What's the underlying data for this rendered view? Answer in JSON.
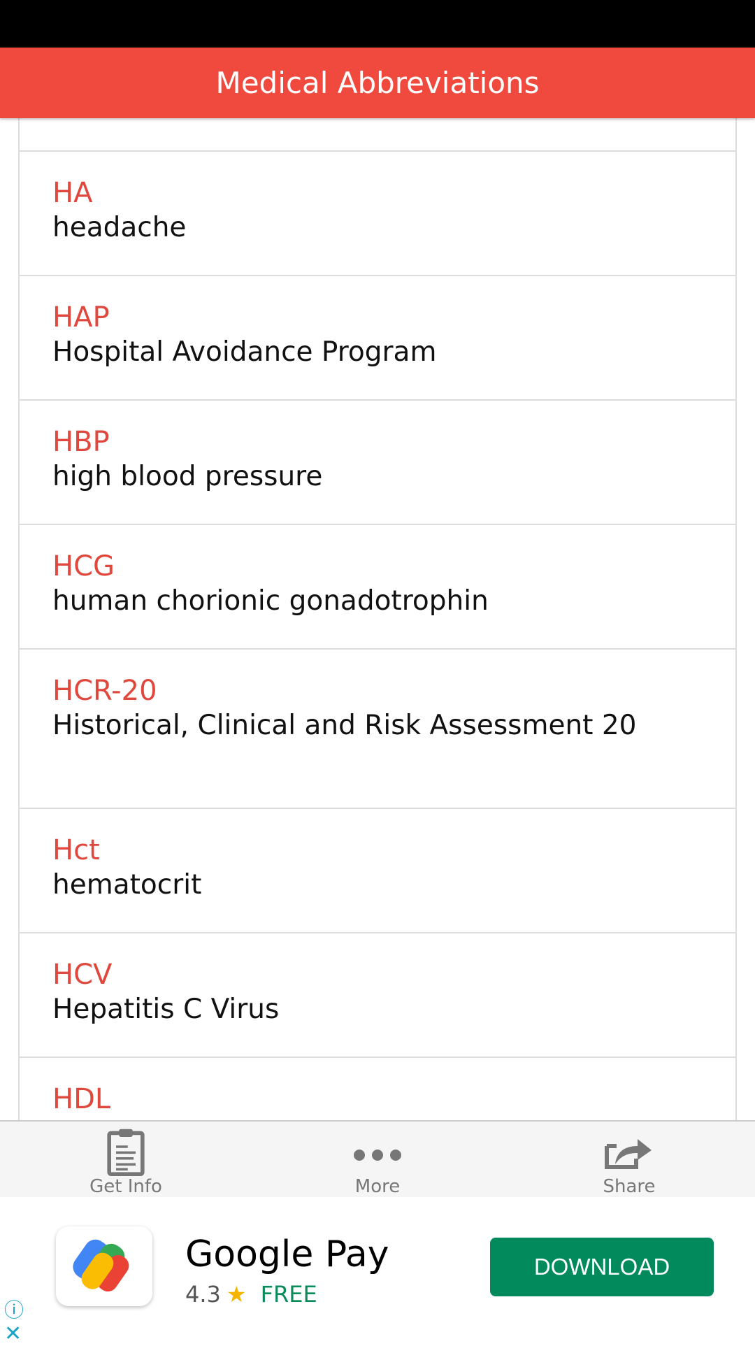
{
  "header": {
    "title": "Medical Abbreviations"
  },
  "items": [
    {
      "abbr": "HA",
      "def": "headache"
    },
    {
      "abbr": "HAP",
      "def": "Hospital Avoidance Program"
    },
    {
      "abbr": "HBP",
      "def": "high blood pressure"
    },
    {
      "abbr": "HCG",
      "def": "human chorionic gonadotrophin"
    },
    {
      "abbr": "HCR-20",
      "def": "Historical, Clinical and Risk Assessment 20"
    },
    {
      "abbr": "Hct",
      "def": "hematocrit"
    },
    {
      "abbr": "HCV",
      "def": "Hepatitis C Virus"
    },
    {
      "abbr": "HDL",
      "def": ""
    }
  ],
  "bottom_bar": [
    {
      "label": "Get Info",
      "icon": "clipboard-icon"
    },
    {
      "label": "More",
      "icon": "more-dots-icon"
    },
    {
      "label": "Share",
      "icon": "share-icon"
    }
  ],
  "ad": {
    "app_name": "Google Pay",
    "rating": "4.3",
    "price": "FREE",
    "button": "DOWNLOAD",
    "info": "ⓘ",
    "close": "✕"
  },
  "colors": {
    "header": "#f04a3e",
    "abbr": "#e0483d",
    "download": "#038a5c"
  }
}
